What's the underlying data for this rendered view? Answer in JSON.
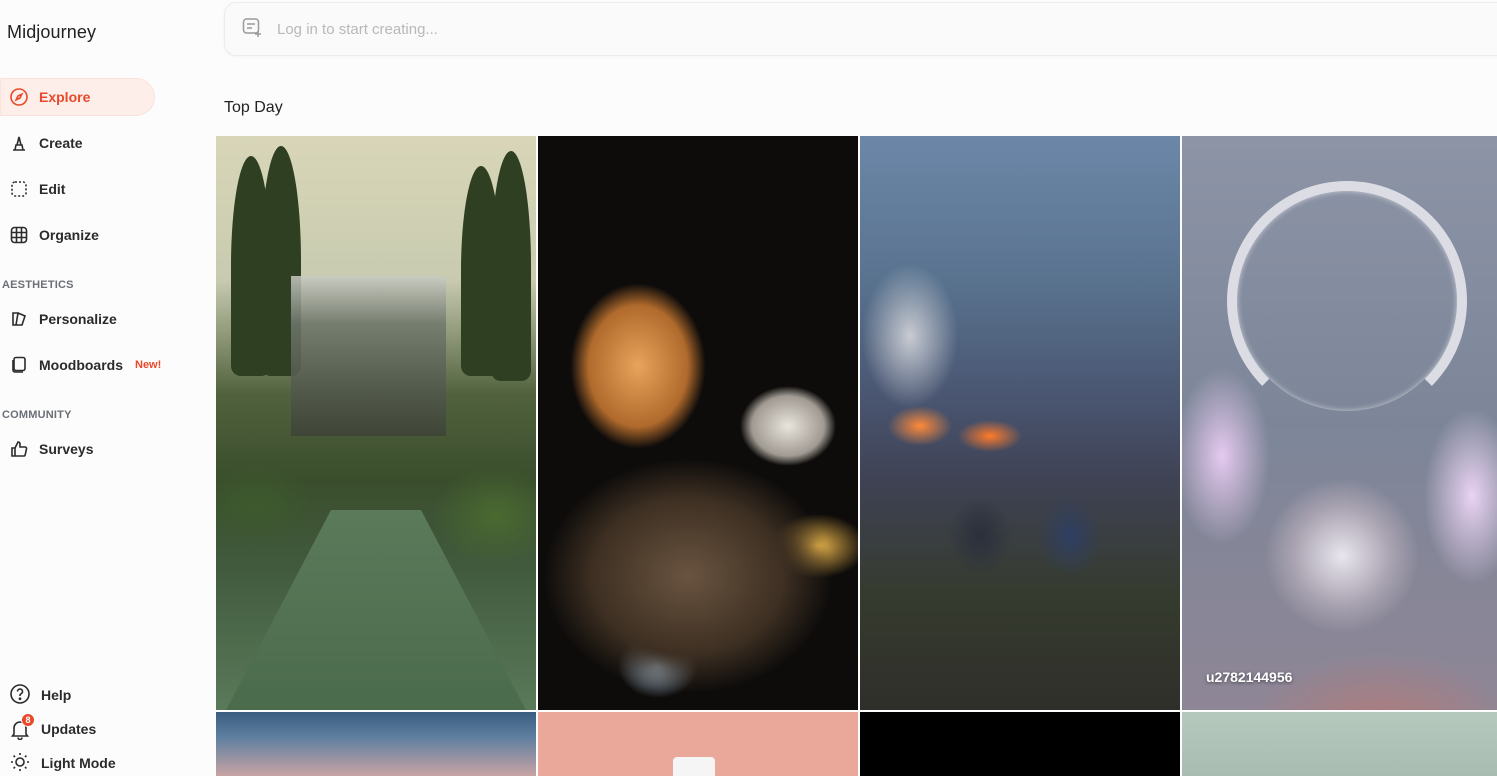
{
  "app": {
    "brand": "Midjourney"
  },
  "sidebar": {
    "nav": [
      {
        "label": "Explore",
        "icon": "compass-icon",
        "active": true
      },
      {
        "label": "Create",
        "icon": "brush-icon",
        "active": false
      },
      {
        "label": "Edit",
        "icon": "edit-frame-icon",
        "active": false
      },
      {
        "label": "Organize",
        "icon": "grid-icon",
        "active": false
      }
    ],
    "aesthetics_label": "AESTHETICS",
    "aesthetics": [
      {
        "label": "Personalize",
        "icon": "personalize-icon"
      },
      {
        "label": "Moodboards",
        "icon": "moodboard-icon",
        "badge": "New!"
      }
    ],
    "community_label": "COMMUNITY",
    "community": [
      {
        "label": "Surveys",
        "icon": "thumbs-up-icon"
      }
    ],
    "bottom": [
      {
        "label": "Help",
        "icon": "help-icon"
      },
      {
        "label": "Updates",
        "icon": "bell-icon",
        "count": "8"
      },
      {
        "label": "Light Mode",
        "icon": "sun-icon"
      }
    ]
  },
  "prompt": {
    "placeholder": "Log in to start creating..."
  },
  "main": {
    "section_title": "Top Day",
    "images": [
      {
        "name": "garden-tennis-court"
      },
      {
        "name": "cats-at-night"
      },
      {
        "name": "city-fire-hillside"
      },
      {
        "name": "crystal-headphones",
        "caption": "u2782144956"
      },
      {
        "name": "sky-clouds"
      },
      {
        "name": "pink-cup"
      },
      {
        "name": "black-image"
      },
      {
        "name": "mint-image"
      }
    ]
  },
  "colors": {
    "accent": "#e8492a",
    "active_bg": "#fdeeea"
  }
}
